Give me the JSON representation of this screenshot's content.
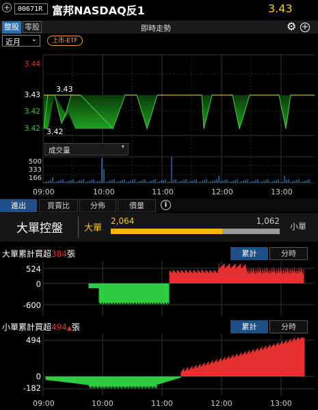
{
  "header": {
    "code": "00671R",
    "name": "富邦NASDAQ反1",
    "price": "3.43"
  },
  "tabs": {
    "main": [
      {
        "label": "整股",
        "active": true
      },
      {
        "label": "零股",
        "active": false
      }
    ],
    "title": "即時走勢"
  },
  "toolbar": {
    "period": "近月",
    "tag": "上市-ETF"
  },
  "price_chart": {
    "y_ticks": [
      {
        "value": "3.44",
        "color": "#e53030"
      },
      {
        "value": "3.43",
        "color": "#ffffff"
      },
      {
        "value": "3.42",
        "color": "#2ecc40"
      },
      {
        "value": "3.42",
        "color": "#2ecc40"
      }
    ],
    "annot_high": "3.43",
    "annot_low": "3.42"
  },
  "volume": {
    "selector": "成交量",
    "y_ticks": [
      "500",
      "333",
      "166"
    ]
  },
  "x_labels": [
    "09:00",
    "10:00",
    "11:00",
    "12:00",
    "13:00"
  ],
  "sub_tabs": [
    {
      "label": "進出",
      "active": true
    },
    {
      "label": "買賣比",
      "active": false
    },
    {
      "label": "分佈",
      "active": false
    },
    {
      "label": "價量",
      "active": false
    }
  ],
  "control": {
    "title": "大單控盤",
    "big_label": "大單",
    "small_label": "小單",
    "big_value": "2,064",
    "small_value": "1,062",
    "big_ratio": 0.66
  },
  "big_panel": {
    "title_prefix": "大單累計買超",
    "title_value": "384",
    "title_suffix": "張",
    "btn_cum": "累計",
    "btn_time": "分時",
    "y_ticks": [
      "524",
      "0",
      "-600"
    ]
  },
  "small_panel": {
    "title_prefix": "小單累計買超",
    "title_value": "494",
    "title_suffix": "張",
    "btn_cum": "累計",
    "btn_time": "分時",
    "y_ticks": [
      "494",
      "0",
      "-182"
    ]
  },
  "colors": {
    "up": "#e53030",
    "down": "#2ecc40",
    "price_line": "#e8e84a",
    "accent": "#ffcc00",
    "volume": "#3aa0ff"
  }
}
